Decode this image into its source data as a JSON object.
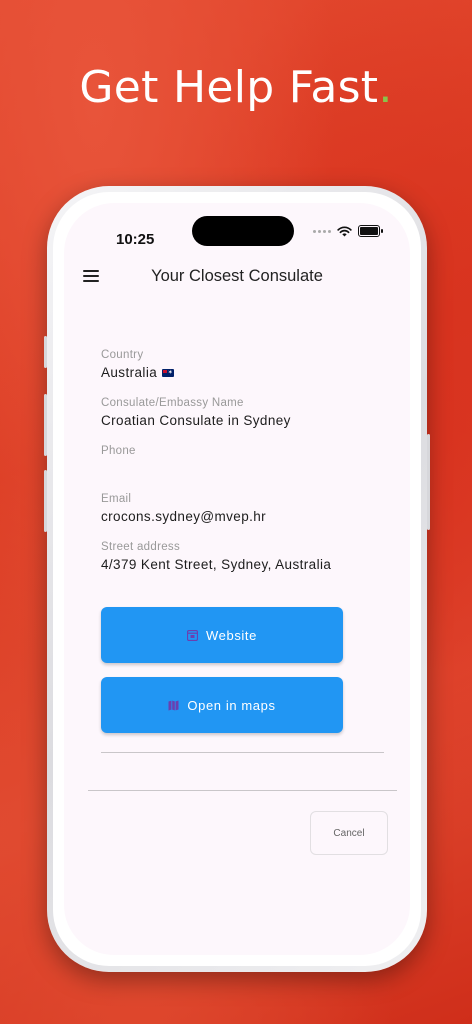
{
  "headline": {
    "text": "Get Help Fast",
    "dot": "."
  },
  "status_bar": {
    "time": "10:25"
  },
  "app_bar": {
    "title": "Your Closest Consulate"
  },
  "fields": {
    "country": {
      "label": "Country",
      "value": "Australia"
    },
    "name": {
      "label": "Consulate/Embassy Name",
      "value": "Croatian Consulate in Sydney"
    },
    "phone": {
      "label": "Phone",
      "value": ""
    },
    "email": {
      "label": "Email",
      "value": "crocons.sydney@mvep.hr"
    },
    "address": {
      "label": "Street address",
      "value": "4/379 Kent Street, Sydney, Australia"
    }
  },
  "buttons": {
    "website": {
      "label": "Website",
      "icon": "web-icon"
    },
    "maps": {
      "label": "Open in maps",
      "icon": "map-icon"
    },
    "cancel": {
      "label": "Cancel"
    }
  },
  "colors": {
    "background": "#dd3d25",
    "accent_dot": "#8bc34a",
    "button": "#2196f3",
    "icon_tint": "#6a3fb0"
  }
}
